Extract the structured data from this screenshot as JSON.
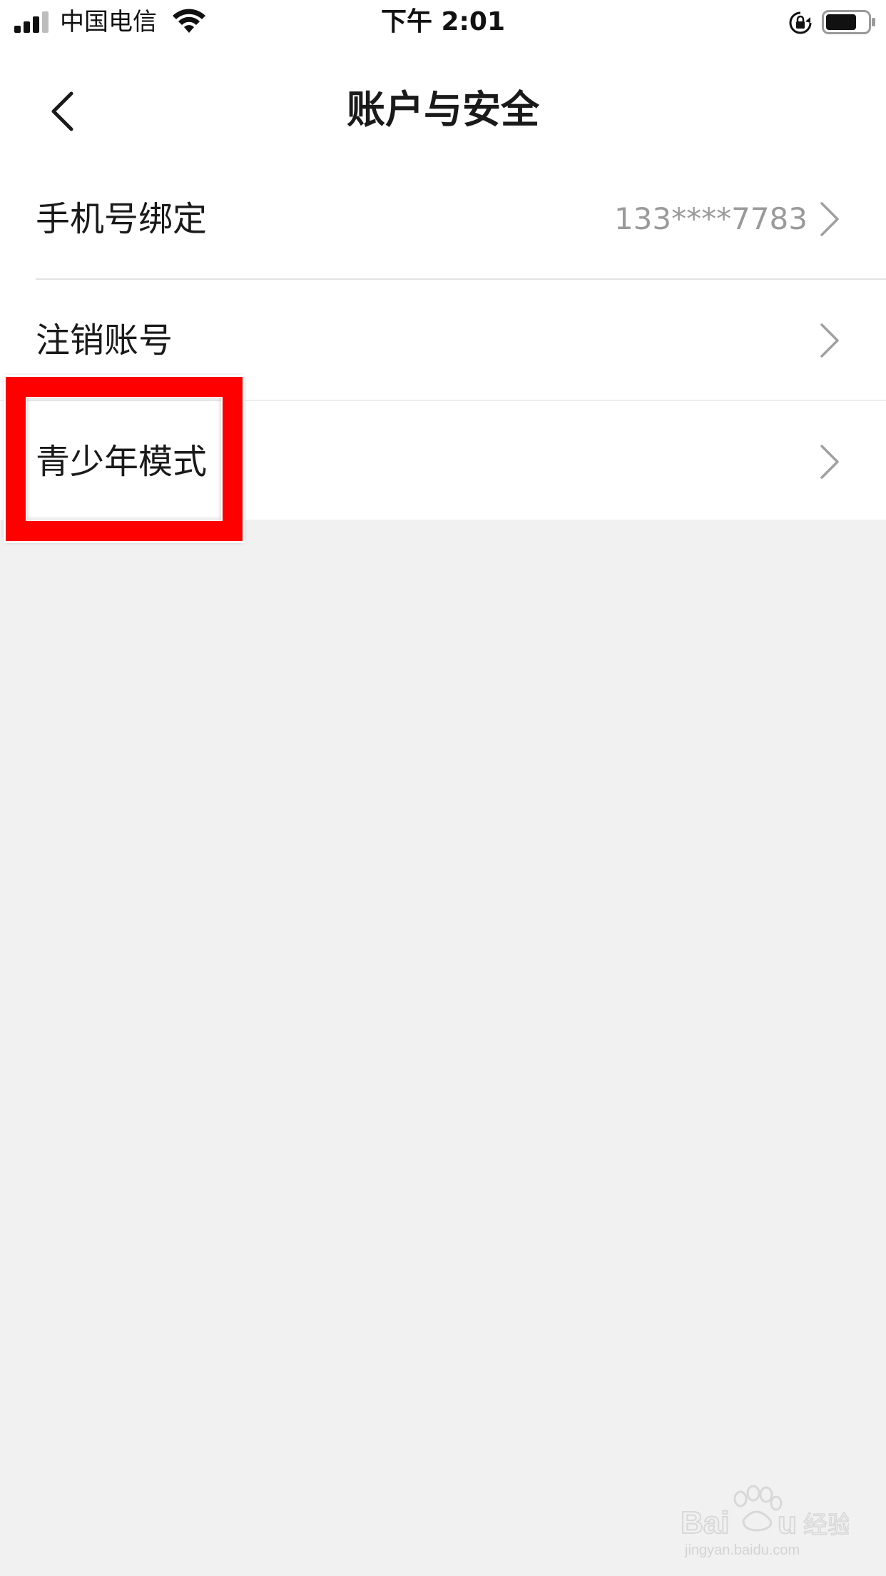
{
  "status_bar": {
    "carrier": "中国电信",
    "time": "下午 2:01"
  },
  "nav": {
    "title": "账户与安全",
    "back_icon": "chevron-left-icon"
  },
  "list": {
    "items": [
      {
        "label": "手机号绑定",
        "value": "133****7783"
      },
      {
        "label": "注销账号",
        "value": ""
      },
      {
        "label": "青少年模式",
        "value": ""
      }
    ]
  },
  "colors": {
    "highlight": "#ff0000",
    "page_background": "#f1f1f1",
    "list_background": "#ffffff",
    "secondary_text": "#9a9a9a"
  },
  "watermark": {
    "brand": "Bai du 经验",
    "url": "jingyan.baidu.com"
  }
}
